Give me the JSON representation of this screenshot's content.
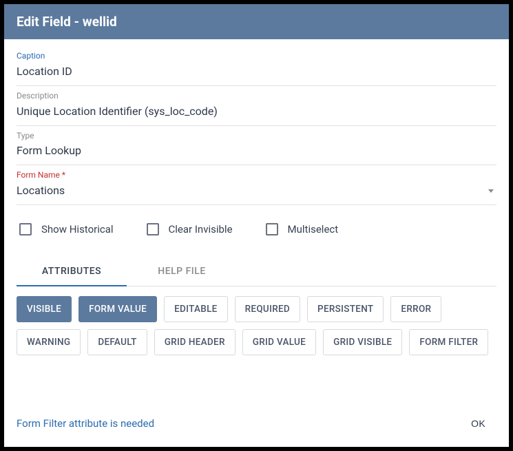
{
  "header": {
    "title": "Edit Field - wellid"
  },
  "fields": {
    "caption": {
      "label": "Caption",
      "value": "Location ID"
    },
    "description": {
      "label": "Description",
      "value": "Unique Location Identifier (sys_loc_code)"
    },
    "type": {
      "label": "Type",
      "value": "Form Lookup"
    },
    "formName": {
      "label": "Form Name *",
      "value": "Locations"
    }
  },
  "checkboxes": {
    "showHistorical": {
      "label": "Show Historical",
      "checked": false
    },
    "clearInvisible": {
      "label": "Clear Invisible",
      "checked": false
    },
    "multiselect": {
      "label": "Multiselect",
      "checked": false
    }
  },
  "tabs": {
    "attributes": "ATTRIBUTES",
    "helpFile": "HELP FILE"
  },
  "attributes": [
    {
      "key": "visible",
      "label": "VISIBLE",
      "selected": true
    },
    {
      "key": "formValue",
      "label": "FORM VALUE",
      "selected": true
    },
    {
      "key": "editable",
      "label": "EDITABLE",
      "selected": false
    },
    {
      "key": "required",
      "label": "REQUIRED",
      "selected": false
    },
    {
      "key": "persistent",
      "label": "PERSISTENT",
      "selected": false
    },
    {
      "key": "error",
      "label": "ERROR",
      "selected": false
    },
    {
      "key": "warning",
      "label": "WARNING",
      "selected": false
    },
    {
      "key": "default",
      "label": "DEFAULT",
      "selected": false
    },
    {
      "key": "gridHeader",
      "label": "GRID HEADER",
      "selected": false
    },
    {
      "key": "gridValue",
      "label": "GRID VALUE",
      "selected": false
    },
    {
      "key": "gridVisible",
      "label": "GRID VISIBLE",
      "selected": false
    },
    {
      "key": "formFilter",
      "label": "FORM FILTER",
      "selected": false
    }
  ],
  "footer": {
    "warning": "Form Filter attribute is needed",
    "ok": "OK"
  }
}
